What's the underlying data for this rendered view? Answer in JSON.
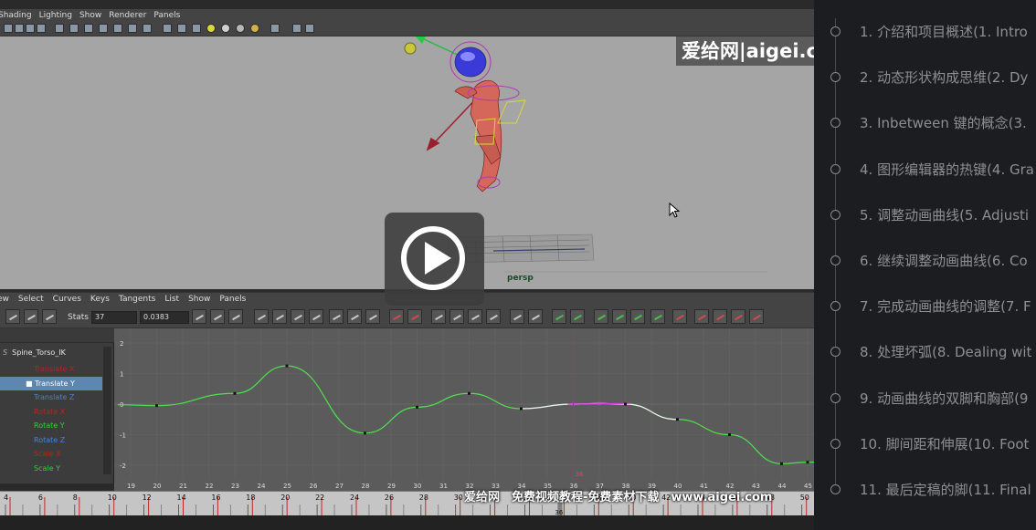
{
  "maya": {
    "menu_top": [
      "Shading",
      "Lighting",
      "Show",
      "Renderer",
      "Panels"
    ],
    "camera_label": "persp",
    "graph_menu": [
      "ew",
      "Select",
      "Curves",
      "Keys",
      "Tangents",
      "List",
      "Show",
      "Panels"
    ],
    "stats_label": "Stats",
    "stats_frame": "37",
    "stats_value": "0.0383",
    "outliner_node": "Spine_Torso_IK",
    "channels": [
      {
        "label": "Translate X",
        "color": "#c02020",
        "selected": false
      },
      {
        "label": "Translate Y",
        "color": "#ffffff",
        "selected": true
      },
      {
        "label": "Translate Z",
        "color": "#4d7fd6",
        "selected": false
      },
      {
        "label": "Rotate X",
        "color": "#c02020",
        "selected": false
      },
      {
        "label": "Rotate Y",
        "color": "#2fd02f",
        "selected": false
      },
      {
        "label": "Rotate Z",
        "color": "#4d7fd6",
        "selected": false
      },
      {
        "label": "Scale X",
        "color": "#c02020",
        "selected": false
      },
      {
        "label": "Scale Y",
        "color": "#2fd02f",
        "selected": false
      }
    ],
    "graph_y_ticks": [
      "2",
      "1",
      "0",
      "-1",
      "-2"
    ],
    "graph_x_ticks": [
      "19",
      "20",
      "21",
      "22",
      "23",
      "24",
      "25",
      "26",
      "27",
      "28",
      "29",
      "30",
      "31",
      "32",
      "33",
      "34",
      "35",
      "36",
      "37",
      "38",
      "39",
      "40",
      "41",
      "42",
      "43",
      "44",
      "45"
    ],
    "current_frame": "36",
    "timeline_ticks": [
      "4",
      "6",
      "8",
      "10",
      "12",
      "14",
      "16",
      "18",
      "20",
      "22",
      "24",
      "26",
      "28",
      "30",
      "32",
      "34",
      "36",
      "38",
      "40",
      "42",
      "44",
      "46",
      "48",
      "50"
    ],
    "timeline_current": "36",
    "curve_keys": [
      {
        "frame": 20,
        "value": -0.05
      },
      {
        "frame": 23,
        "value": 0.35
      },
      {
        "frame": 25,
        "value": 1.25
      },
      {
        "frame": 28,
        "value": -0.95
      },
      {
        "frame": 30,
        "value": -0.1
      },
      {
        "frame": 32,
        "value": 0.35
      },
      {
        "frame": 34,
        "value": -0.15
      },
      {
        "frame": 36,
        "value": 0.0
      },
      {
        "frame": 37,
        "value": 0.02
      },
      {
        "frame": 38,
        "value": 0.0
      },
      {
        "frame": 40,
        "value": -0.5
      },
      {
        "frame": 42,
        "value": -1.0
      },
      {
        "frame": 44,
        "value": -1.95
      },
      {
        "frame": 45,
        "value": -1.9
      }
    ]
  },
  "watermark_top": "爱给网|aigei.c",
  "watermark_bottom": "爱给网　免费视频教程-免费素材下载　www.aigei.com",
  "playlist": [
    "1. 介绍和项目概述(1. Intro",
    "2. 动态形状构成思维(2. Dy",
    "3. Inbetween 键的概念(3.",
    "4. 图形编辑器的热键(4. Gra",
    "5. 调整动画曲线(5. Adjusti",
    "6. 继续调整动画曲线(6. Co",
    "7. 完成动画曲线的调整(7. F",
    "8. 处理坏弧(8. Dealing wit",
    "9. 动画曲线的双脚和胸部(9",
    "10. 脚间距和伸展(10. Foot",
    "11. 最后定稿的脚(11. Final"
  ]
}
